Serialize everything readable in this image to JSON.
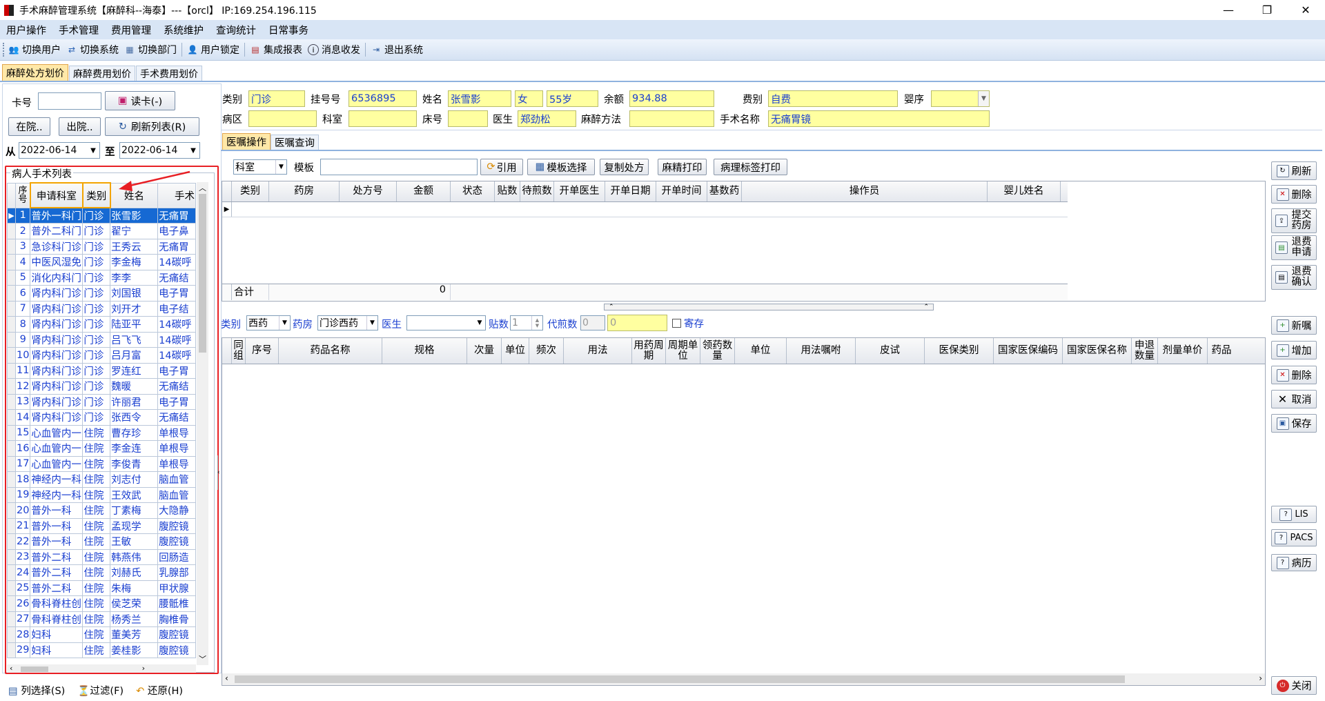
{
  "window": {
    "title": "手术麻醉管理系统【麻醉科--海泰】---【orcl】 IP:169.254.196.115",
    "min": "—",
    "restore": "❐",
    "close": "✕"
  },
  "menu": [
    "用户操作",
    "手术管理",
    "费用管理",
    "系统维护",
    "查询统计",
    "日常事务"
  ],
  "toolbar": [
    {
      "label": "切换用户",
      "icon": "users-icon"
    },
    {
      "label": "切换系统",
      "icon": "switch-system-icon"
    },
    {
      "label": "切换部门",
      "icon": "department-icon"
    },
    {
      "label": "用户锁定",
      "icon": "user-lock-icon"
    },
    {
      "label": "集成报表",
      "icon": "report-icon"
    },
    {
      "label": "消息收发",
      "icon": "info-icon"
    },
    {
      "label": "退出系统",
      "icon": "exit-icon"
    }
  ],
  "main_tabs": [
    "麻醉处方划价",
    "麻醉费用划价",
    "手术费用划价"
  ],
  "left": {
    "card_label": "卡号",
    "read_card": "读卡(-)",
    "in_hospital": "在院..",
    "discharged": "出院..",
    "refresh": "刷新列表(R)",
    "from": "从",
    "to": "至",
    "date_from": "2022-06-14",
    "date_to": "2022-06-14",
    "group_title": "病人手术列表",
    "columns": [
      "序号",
      "申请科室",
      "类别",
      "姓名",
      "手术"
    ],
    "rows": [
      [
        "1",
        "普外一科门",
        "门诊",
        "张雪影",
        "无痛胃"
      ],
      [
        "2",
        "普外二科门",
        "门诊",
        "翟宁",
        "电子鼻"
      ],
      [
        "3",
        "急诊科门诊",
        "门诊",
        "王秀云",
        "无痛胃"
      ],
      [
        "4",
        "中医风湿免",
        "门诊",
        "李金梅",
        "14碳呼"
      ],
      [
        "5",
        "消化内科门",
        "门诊",
        "李李",
        "无痛结"
      ],
      [
        "6",
        "肾内科门诊",
        "门诊",
        "刘国银",
        "电子胃"
      ],
      [
        "7",
        "肾内科门诊",
        "门诊",
        "刘开才",
        "电子结"
      ],
      [
        "8",
        "肾内科门诊",
        "门诊",
        "陆亚平",
        "14碳呼"
      ],
      [
        "9",
        "肾内科门诊",
        "门诊",
        "吕飞飞",
        "14碳呼"
      ],
      [
        "10",
        "肾内科门诊",
        "门诊",
        "吕月富",
        "14碳呼"
      ],
      [
        "11",
        "肾内科门诊",
        "门诊",
        "罗连红",
        "电子胃"
      ],
      [
        "12",
        "肾内科门诊",
        "门诊",
        "魏暖",
        "无痛结"
      ],
      [
        "13",
        "肾内科门诊",
        "门诊",
        "许丽君",
        "电子胃"
      ],
      [
        "14",
        "肾内科门诊",
        "门诊",
        "张西令",
        "无痛结"
      ],
      [
        "15",
        "心血管内一",
        "住院",
        "曹存珍",
        "单根导"
      ],
      [
        "16",
        "心血管内一",
        "住院",
        "李金连",
        "单根导"
      ],
      [
        "17",
        "心血管内一",
        "住院",
        "李俊青",
        "单根导"
      ],
      [
        "18",
        "神经内一科",
        "住院",
        "刘志付",
        "脑血管"
      ],
      [
        "19",
        "神经内一科",
        "住院",
        "王效武",
        "脑血管"
      ],
      [
        "20",
        "普外一科",
        "住院",
        "丁素梅",
        "大隐静"
      ],
      [
        "21",
        "普外一科",
        "住院",
        "孟现学",
        "腹腔镜"
      ],
      [
        "22",
        "普外一科",
        "住院",
        "王敏",
        "腹腔镜"
      ],
      [
        "23",
        "普外二科",
        "住院",
        "韩燕伟",
        "回肠造"
      ],
      [
        "24",
        "普外二科",
        "住院",
        "刘赫氏",
        "乳腺部"
      ],
      [
        "25",
        "普外二科",
        "住院",
        "朱梅",
        "甲状腺"
      ],
      [
        "26",
        "骨科脊柱创",
        "住院",
        "侯芝荣",
        "腰骶椎"
      ],
      [
        "27",
        "骨科脊柱创",
        "住院",
        "杨秀兰",
        "胸椎骨"
      ],
      [
        "28",
        "妇科",
        "住院",
        "董美芳",
        "腹腔镜"
      ],
      [
        "29",
        "妇科",
        "住院",
        "姜桂影",
        "腹腔镜"
      ]
    ],
    "bottom_buttons": [
      "列选择(S)",
      "过滤(F)",
      "还原(H)"
    ]
  },
  "patient": {
    "type_label": "类别",
    "type": "门诊",
    "reg_label": "挂号号",
    "reg": "6536895",
    "name_label": "姓名",
    "name": "张雪影",
    "sex": "女",
    "age": "55岁",
    "balance_label": "余额",
    "balance": "934.88",
    "fee_label": "费别",
    "fee": "自费",
    "infant_label": "婴序",
    "infant": "",
    "ward_label": "病区",
    "ward": "",
    "dept_label": "科室",
    "dept": "",
    "bed_label": "床号",
    "bed": "",
    "doctor_label": "医生",
    "doctor": "郑劲松",
    "anes_label": "麻醉方法",
    "anes": "",
    "surgery_label": "手术名称",
    "surgery": "无痛胃镜"
  },
  "order_tabs": [
    "医嘱操作",
    "医嘱查询"
  ],
  "order_toolbar": {
    "dept_select": "科室",
    "template_label": "模板",
    "template_value": "",
    "buttons": [
      "引用",
      "模板选择",
      "复制处方",
      "麻精打印",
      "病理标签打印"
    ]
  },
  "order_grid": {
    "columns": [
      "类别",
      "药房",
      "处方号",
      "金额",
      "状态",
      "贴数",
      "待煎数",
      "开单医生",
      "开单日期",
      "开单时间",
      "基数药",
      "操作员",
      "婴儿姓名"
    ],
    "total_label": "合计",
    "total_value": "0"
  },
  "right_buttons_top": [
    "刷新",
    "删除",
    "提交药房",
    "退费申请",
    "退费确认"
  ],
  "detail_bar": {
    "type_label": "类别",
    "type": "西药",
    "pharmacy_label": "药房",
    "pharmacy": "门诊西药",
    "doctor_label": "医生",
    "doctor": "",
    "doses_label": "贴数",
    "doses": "1",
    "decoct_label": "代煎数",
    "decoct": "0",
    "decoct2": "0",
    "deposit_label": "寄存"
  },
  "detail_grid": {
    "columns": [
      "同组",
      "序号",
      "药品名称",
      "规格",
      "次量",
      "单位",
      "频次",
      "用法",
      "用药周期",
      "周期单位",
      "领药数量",
      "单位",
      "用法嘱咐",
      "皮试",
      "医保类别",
      "国家医保编码",
      "国家医保名称",
      "申退数量",
      "剂量单价",
      "药品"
    ]
  },
  "right_buttons_mid": [
    "新嘱",
    "增加",
    "删除",
    "取消",
    "保存"
  ],
  "right_buttons_bottom": [
    "LIS",
    "PACS",
    "病历"
  ],
  "close_button": "关闭",
  "colors": {
    "accent": "#1669d3",
    "highlight": "#ffffa0",
    "frame_red": "#e81f24",
    "frame_orange": "#f2a400"
  }
}
